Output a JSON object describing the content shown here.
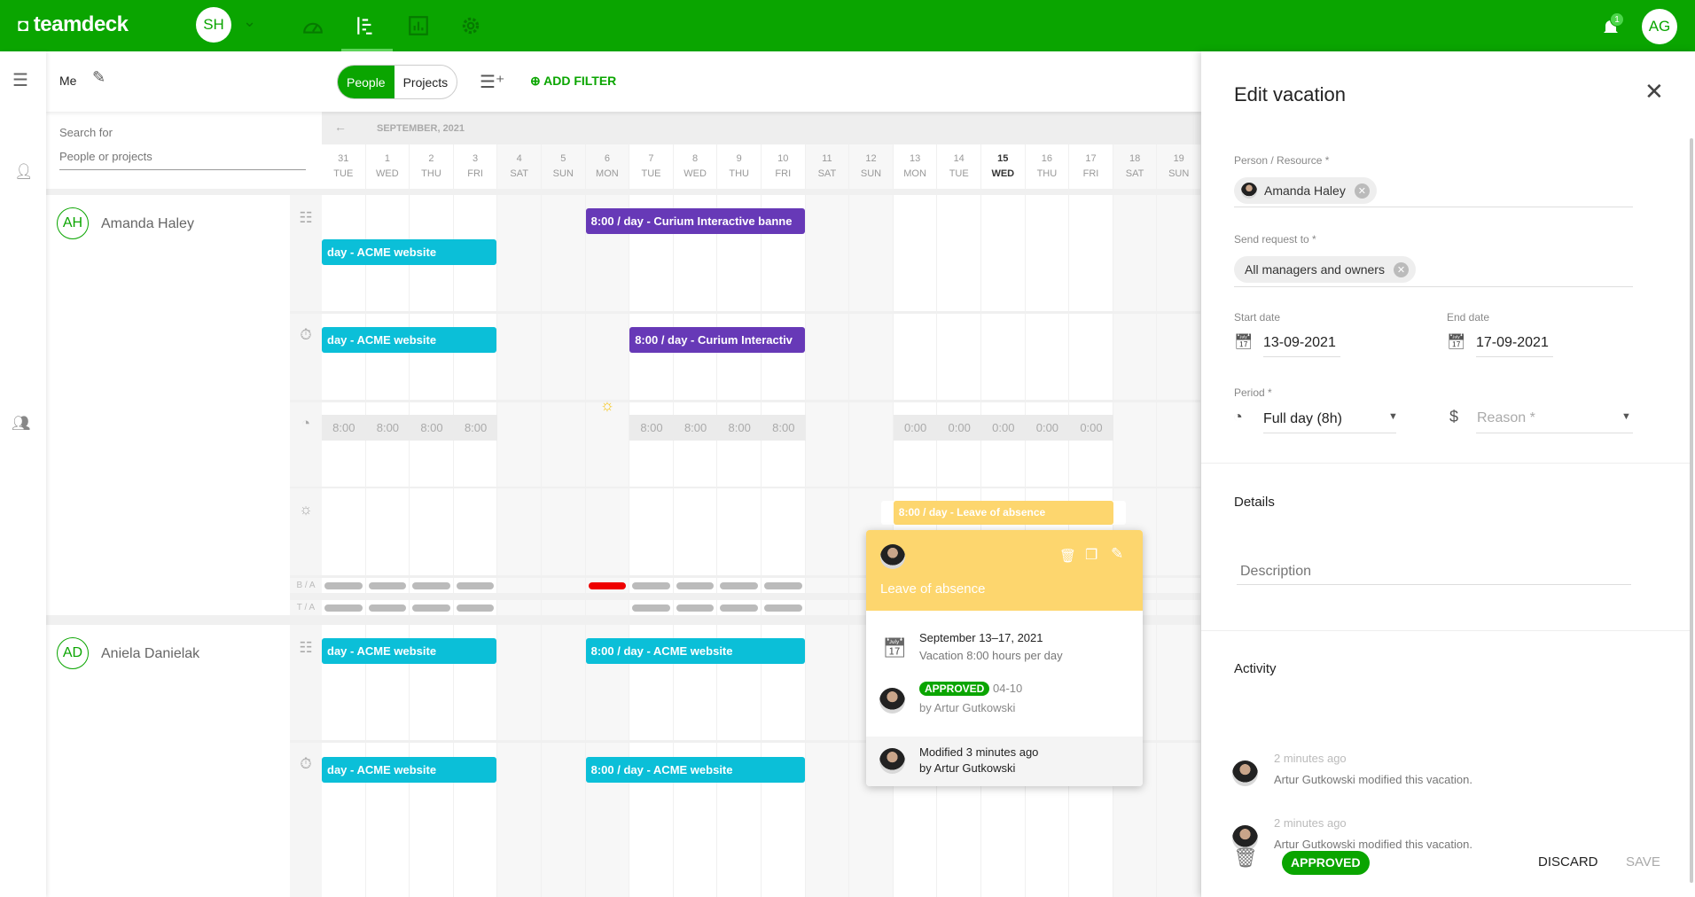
{
  "topbar": {
    "logo": "teamdeck",
    "workspace_initials": "SH",
    "nav_icons": [
      "dashboard-icon",
      "planner-icon",
      "reports-icon",
      "settings-icon"
    ],
    "active_nav": "planner-icon",
    "notification_count": "1",
    "user_initials": "AG",
    "brand_color": "#0aa500"
  },
  "toolbar": {
    "view_label": "Me",
    "toggle": [
      "People",
      "Projects"
    ],
    "active_toggle": "People",
    "add_filter": "ADD FILTER"
  },
  "search": {
    "label": "Search for",
    "placeholder": "People or projects"
  },
  "calendar": {
    "month": "SEPTEMBER, 2021",
    "today": "15",
    "days": [
      {
        "d": "31",
        "w": "TUE"
      },
      {
        "d": "1",
        "w": "WED"
      },
      {
        "d": "2",
        "w": "THU"
      },
      {
        "d": "3",
        "w": "FRI"
      },
      {
        "d": "4",
        "w": "SAT",
        "off": true
      },
      {
        "d": "5",
        "w": "SUN",
        "off": true
      },
      {
        "d": "6",
        "w": "MON",
        "off": true
      },
      {
        "d": "7",
        "w": "TUE"
      },
      {
        "d": "8",
        "w": "WED"
      },
      {
        "d": "9",
        "w": "THU"
      },
      {
        "d": "10",
        "w": "FRI"
      },
      {
        "d": "11",
        "w": "SAT",
        "off": true
      },
      {
        "d": "12",
        "w": "SUN",
        "off": true
      },
      {
        "d": "13",
        "w": "MON"
      },
      {
        "d": "14",
        "w": "TUE"
      },
      {
        "d": "15",
        "w": "WED"
      },
      {
        "d": "16",
        "w": "THU"
      },
      {
        "d": "17",
        "w": "FRI"
      },
      {
        "d": "18",
        "w": "SAT",
        "off": true
      },
      {
        "d": "19",
        "w": "SUN",
        "off": true
      }
    ],
    "row_labels": {
      "ba": "B / A",
      "ta": "T / A"
    },
    "colors": {
      "cyan": "#0bbfd8",
      "purple": "#6739b7",
      "yellow": "#fdd66e",
      "red": "#ee0000"
    }
  },
  "people": [
    {
      "initials": "AH",
      "name": "Amanda Haley",
      "project_bars": [
        {
          "text": "day - ACME website",
          "from": "31",
          "to": "3",
          "color": "cyan",
          "lane": 1
        },
        {
          "text": "8:00 / day - Curium Interactive banne",
          "from": "6",
          "to": "10",
          "color": "purple",
          "lane": 0
        }
      ],
      "timer_bars": [
        {
          "text": "day - ACME website",
          "from": "31",
          "to": "3",
          "color": "cyan"
        },
        {
          "text": "8:00 / day - Curium Interactiv",
          "from": "7",
          "to": "10",
          "color": "purple"
        }
      ],
      "capacity": [
        {
          "day": "31",
          "v": "8:00"
        },
        {
          "day": "1",
          "v": "8:00"
        },
        {
          "day": "2",
          "v": "8:00"
        },
        {
          "day": "3",
          "v": "8:00"
        },
        {
          "day": "7",
          "v": "8:00"
        },
        {
          "day": "8",
          "v": "8:00"
        },
        {
          "day": "9",
          "v": "8:00"
        },
        {
          "day": "10",
          "v": "8:00"
        },
        {
          "day": "13",
          "v": "0:00"
        },
        {
          "day": "14",
          "v": "0:00"
        },
        {
          "day": "15",
          "v": "0:00"
        },
        {
          "day": "16",
          "v": "0:00"
        },
        {
          "day": "17",
          "v": "0:00"
        }
      ],
      "holiday_day": "6",
      "vacation_bar": {
        "text": "8:00 / day - Leave of absence",
        "from": "13",
        "to": "17"
      },
      "ba": [
        "31",
        "1",
        "2",
        "3",
        "7",
        "8",
        "9",
        "10"
      ],
      "ba_over": [
        "6"
      ],
      "ta": [
        "31",
        "1",
        "2",
        "3",
        "7",
        "8",
        "9",
        "10"
      ]
    },
    {
      "initials": "AD",
      "name": "Aniela Danielak",
      "project_bars": [
        {
          "text": "day - ACME website",
          "from": "31",
          "to": "3",
          "color": "cyan"
        },
        {
          "text": "8:00 / day - ACME website",
          "from": "6",
          "to": "10",
          "color": "cyan"
        }
      ],
      "timer_bars": [
        {
          "text": "day - ACME website",
          "from": "31",
          "to": "3",
          "color": "cyan"
        },
        {
          "text": "8:00 / day - ACME website",
          "from": "6",
          "to": "10",
          "color": "cyan"
        }
      ]
    }
  ],
  "popover": {
    "title": "Leave of absence",
    "dates": "September 13–17, 2021",
    "summary": "Vacation 8:00 hours per day",
    "status": "APPROVED",
    "status_date": "04-10",
    "approved_by": "by Artur Gutkowski",
    "modified": "Modified 3 minutes ago",
    "modified_by": "by Artur Gutkowski"
  },
  "panel": {
    "title": "Edit vacation",
    "person_label": "Person / Resource *",
    "person": "Amanda Haley",
    "send_label": "Send request to *",
    "send_to": "All managers and owners",
    "start_label": "Start date",
    "start": "13-09-2021",
    "end_label": "End date",
    "end": "17-09-2021",
    "period_label": "Period *",
    "period": "Full day (8h)",
    "reason_placeholder": "Reason *",
    "details_title": "Details",
    "description_placeholder": "Description",
    "activity_title": "Activity",
    "activity": [
      {
        "time": "2 minutes ago",
        "text": "Artur Gutkowski modified this vacation."
      },
      {
        "time": "2 minutes ago",
        "text": "Artur Gutkowski modified this vacation."
      }
    ],
    "status": "APPROVED",
    "discard": "DISCARD",
    "save": "SAVE"
  }
}
